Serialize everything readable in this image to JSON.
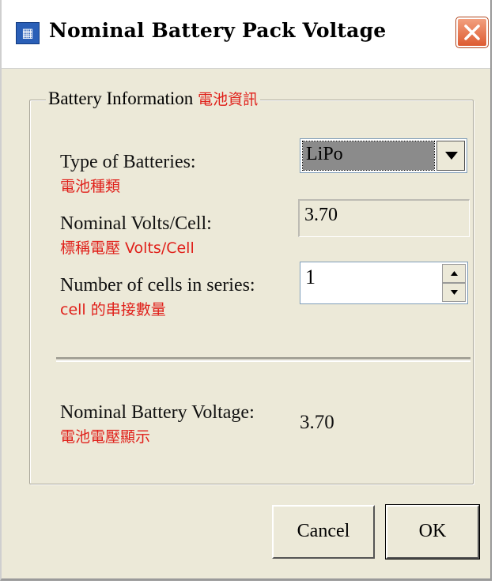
{
  "window": {
    "title": "Nominal Battery Pack Voltage",
    "icon": "app-icon",
    "icon_glyph": "▦",
    "close_icon": "close-icon"
  },
  "group": {
    "legend": "Battery Information",
    "legend_zh": "電池資訊"
  },
  "fields": {
    "battery_type": {
      "label": "Type of Batteries:",
      "label_zh": "電池種類",
      "value": "LiPo"
    },
    "volts_per_cell": {
      "label": "Nominal Volts/Cell:",
      "label_zh": "標稱電壓 Volts/Cell",
      "value": "3.70"
    },
    "cells_in_series": {
      "label": "Number of cells in series:",
      "label_zh": "cell 的串接數量",
      "value": "1"
    }
  },
  "result": {
    "label": "Nominal Battery Voltage:",
    "label_zh": "電池電壓顯示",
    "value": "3.70"
  },
  "buttons": {
    "cancel": "Cancel",
    "ok": "OK"
  },
  "colors": {
    "annotation_red": "#e0201a",
    "dialog_bg": "#ece9d8",
    "close_button": "#dd5b31"
  }
}
